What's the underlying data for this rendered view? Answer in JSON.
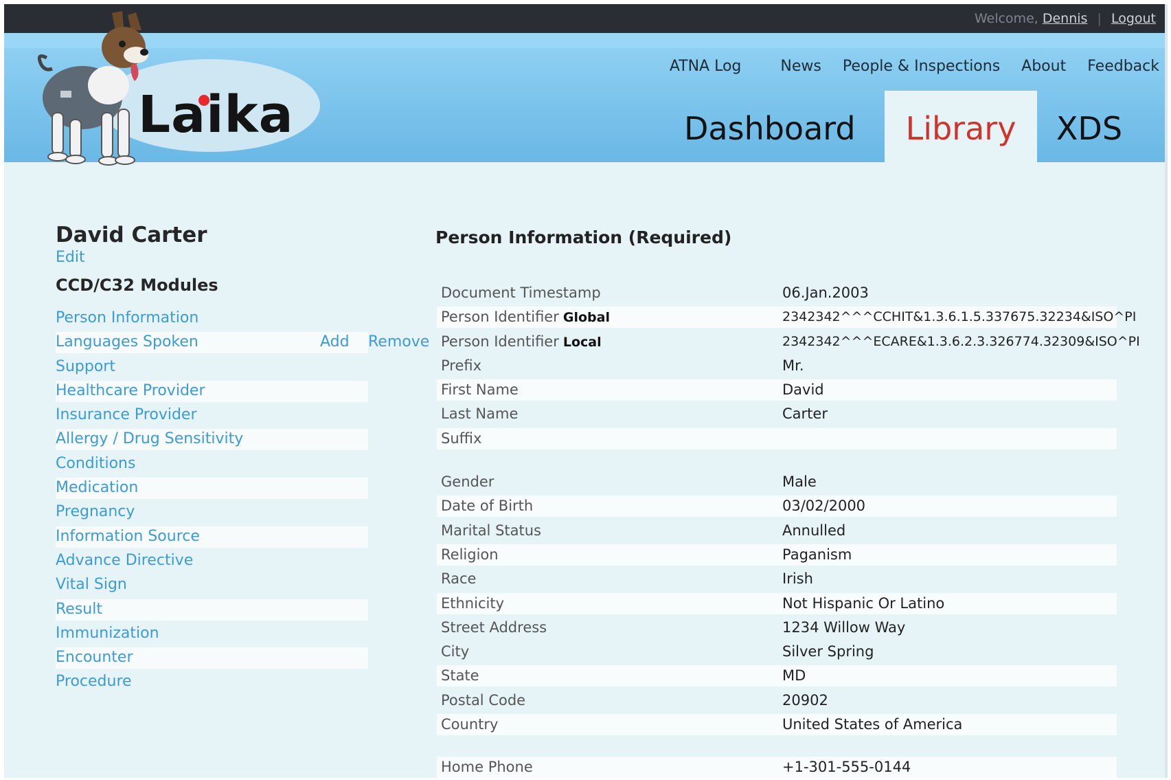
{
  "header": {
    "welcome_prefix": "Welcome,",
    "user": "Dennis",
    "separator": "|",
    "logout": "Logout",
    "logo": "Laika",
    "topnav": [
      "ATNA Log",
      "News",
      "People & Inspections",
      "About",
      "Feedback"
    ],
    "tabs": [
      "Dashboard",
      "Library",
      "XDS"
    ],
    "active_tab": "Library",
    "colors": {
      "top_bar": "#2a2d33",
      "header": "#7cc4ec",
      "active_tab_text": "#d0322c",
      "link": "#3c9bd6"
    }
  },
  "patient": {
    "name": "David Carter",
    "edit": "Edit",
    "modules_title": "CCD/C32 Modules",
    "modules": [
      "Person Information",
      "Languages Spoken",
      "Support",
      "Healthcare Provider",
      "Insurance Provider",
      "Allergy / Drug Sensitivity",
      "Conditions",
      "Medication",
      "Pregnancy",
      "Information Source",
      "Advance Directive",
      "Vital Sign",
      "Result",
      "Immunization",
      "Encounter",
      "Procedure"
    ],
    "module_actions": {
      "add": "Add",
      "remove": "Remove"
    }
  },
  "person_info": {
    "title": "Person Information (Required)",
    "group1": [
      {
        "label": "Document Timestamp",
        "sub": "",
        "value": "06.Jan.2003"
      },
      {
        "label": "Person Identifier",
        "sub": "Global",
        "value": "2342342^^^CCHIT&1.3.6.1.5.337675.32234&ISO^PI"
      },
      {
        "label": "Person Identifier",
        "sub": "Local",
        "value": "2342342^^^ECARE&1.3.6.2.3.326774.32309&ISO^PI"
      },
      {
        "label": "Prefix",
        "sub": "",
        "value": "Mr."
      },
      {
        "label": "First Name",
        "sub": "",
        "value": "David"
      },
      {
        "label": "Last Name",
        "sub": "",
        "value": "Carter"
      },
      {
        "label": "Suffix",
        "sub": "",
        "value": ""
      }
    ],
    "group2": [
      {
        "label": "Gender",
        "value": "Male"
      },
      {
        "label": "Date of Birth",
        "value": "03/02/2000"
      },
      {
        "label": "Marital Status",
        "value": "Annulled"
      },
      {
        "label": "Religion",
        "value": "Paganism"
      },
      {
        "label": "Race",
        "value": "Irish"
      },
      {
        "label": "Ethnicity",
        "value": "Not Hispanic Or Latino"
      },
      {
        "label": "Street Address",
        "value": "1234 Willow Way"
      },
      {
        "label": "City",
        "value": "Silver Spring"
      },
      {
        "label": "State",
        "value": "MD"
      },
      {
        "label": "Postal Code",
        "value": "20902"
      },
      {
        "label": "Country",
        "value": "United States of America"
      }
    ],
    "group3": [
      {
        "label": "Home Phone",
        "value": "+1-301-555-0144"
      }
    ]
  }
}
